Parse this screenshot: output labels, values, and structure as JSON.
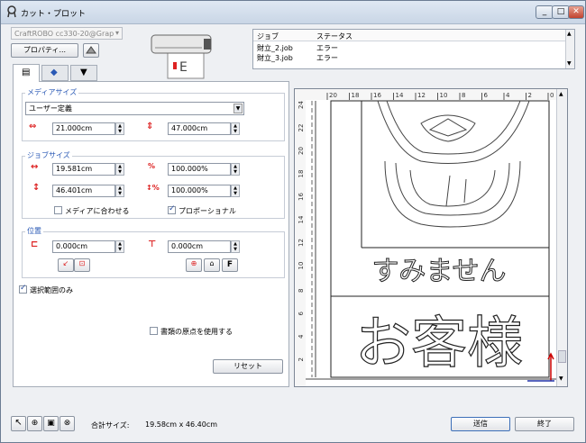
{
  "window": {
    "title": "カット・プロット"
  },
  "device": {
    "selected": "CraftROBO cc330-20@Grap",
    "properties_label": "プロパティ..."
  },
  "jobs": {
    "headers": [
      "ジョブ",
      "ステータス"
    ],
    "rows": [
      {
        "job": "財立_2.job",
        "status": "エラー"
      },
      {
        "job": "財立_3.job",
        "status": "エラー"
      }
    ]
  },
  "media_size": {
    "label": "メディアサイズ",
    "selected": "ユーザー定義",
    "width": "21.000cm",
    "height": "47.000cm"
  },
  "job_size": {
    "label": "ジョブサイズ",
    "width": "19.581cm",
    "height": "46.401cm",
    "scale_x": "100.000%",
    "scale_y": "100.000%",
    "fit_media_label": "メディアに合わせる",
    "fit_media_checked": false,
    "proportional_label": "プロポーショナル",
    "proportional_checked": true
  },
  "position": {
    "label": "位置",
    "x": "0.000cm",
    "y": "0.000cm",
    "f_button": "F"
  },
  "selection_only": {
    "label": "選択範囲のみ",
    "checked": true
  },
  "use_doc_origin": {
    "label": "書類の原点を使用する",
    "checked": false
  },
  "reset_label": "リセット",
  "canvas": {
    "ruler_top": [
      "20",
      "18",
      "16",
      "14",
      "12",
      "10",
      "8",
      "6",
      "4",
      "2",
      "0"
    ],
    "ruler_left": [
      "24",
      "22",
      "20",
      "18",
      "16",
      "14",
      "12",
      "10",
      "8",
      "6",
      "4",
      "2"
    ],
    "text_mid": "すみません",
    "text_bottom": "お客様"
  },
  "status": {
    "total_size_label": "合計サイズ:",
    "total_size_value": "19.58cm x 46.40cm"
  },
  "buttons": {
    "send": "送信",
    "close": "終了"
  }
}
